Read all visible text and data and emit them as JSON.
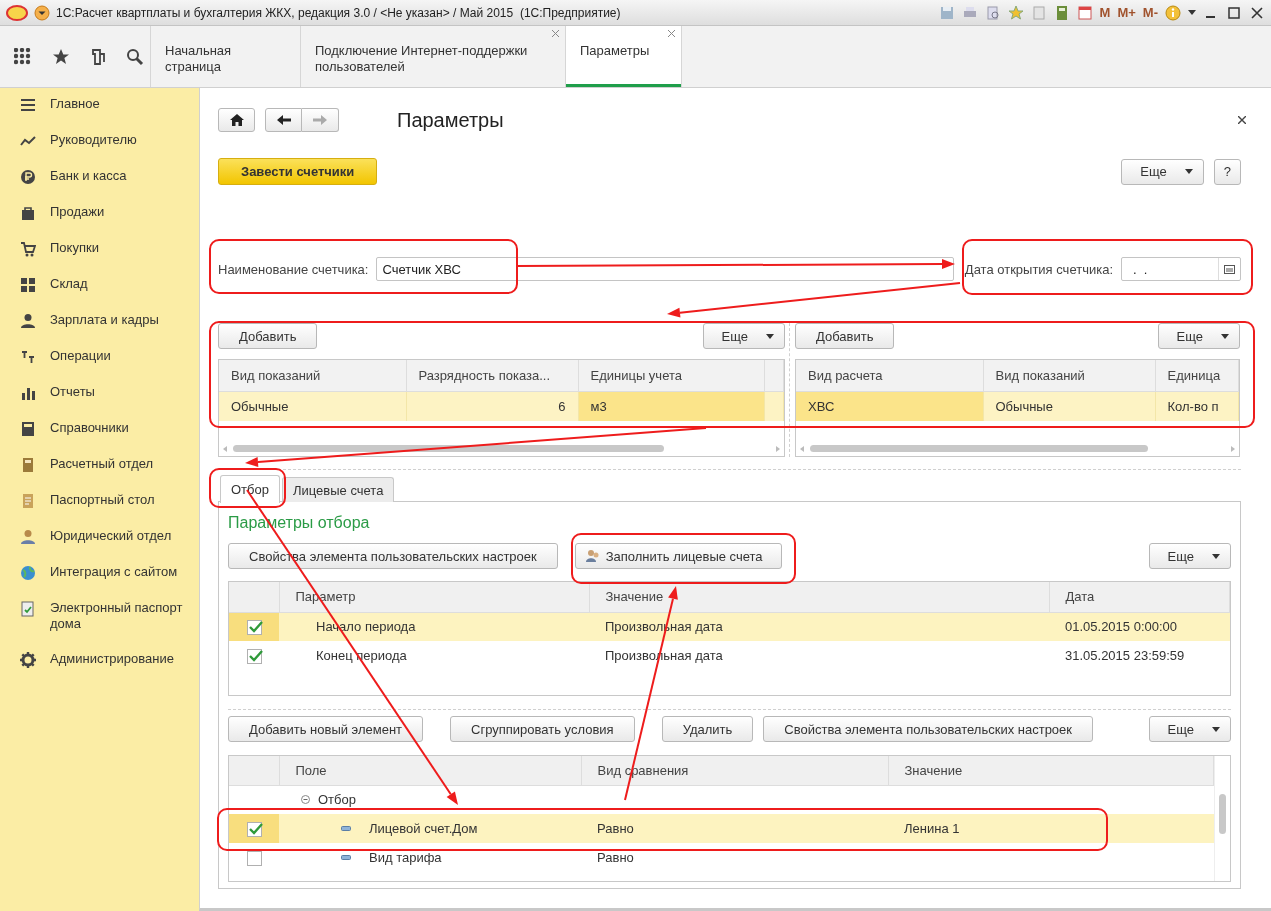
{
  "window": {
    "title": "1С:Расчет квартплаты и бухгалтерия ЖКХ, редакция 3.0 / <Не указан> / Май 2015  (1С:Предприятие)",
    "memory_buttons": [
      "M",
      "M+",
      "M-"
    ]
  },
  "open_tabs": [
    {
      "label": "Начальная страница",
      "selected": false,
      "closable": false
    },
    {
      "label": "Подключение Интернет-поддержки пользователей",
      "selected": false,
      "closable": true
    },
    {
      "label": "Параметры",
      "selected": true,
      "closable": true
    }
  ],
  "sidebar": {
    "items": [
      {
        "label": "Главное"
      },
      {
        "label": "Руководителю"
      },
      {
        "label": "Банк и касса"
      },
      {
        "label": "Продажи"
      },
      {
        "label": "Покупки"
      },
      {
        "label": "Склад"
      },
      {
        "label": "Зарплата и кадры"
      },
      {
        "label": "Операции"
      },
      {
        "label": "Отчеты"
      },
      {
        "label": "Справочники"
      },
      {
        "label": "Расчетный отдел"
      },
      {
        "label": "Паспортный стол"
      },
      {
        "label": "Юридический отдел"
      },
      {
        "label": "Интеграция с сайтом"
      },
      {
        "label": "Электронный паспорт дома"
      },
      {
        "label": "Администрирование"
      }
    ]
  },
  "form": {
    "title": "Параметры",
    "primary_button": "Завести счетчики",
    "more_button": "Еще",
    "help_button": "?",
    "meter_name": {
      "label": "Наименование счетчика:",
      "value": "Счетчик ХВС"
    },
    "open_date": {
      "label": "Дата открытия счетчика:",
      "value": ".  ."
    },
    "readings_table": {
      "add_button": "Добавить",
      "more_button": "Еще",
      "columns": [
        {
          "title": "Вид показаний",
          "numeric": false
        },
        {
          "title": "Разрядность показа...",
          "numeric": true
        },
        {
          "title": "Единицы учета",
          "numeric": false
        }
      ],
      "rows": [
        {
          "selected": true,
          "cells": [
            {
              "text": "Обычные",
              "current": false
            },
            {
              "text": "6",
              "current": false
            },
            {
              "text": "м3",
              "current": true
            }
          ]
        }
      ]
    },
    "calculation_table": {
      "add_button": "Добавить",
      "more_button": "Еще",
      "columns": [
        {
          "title": "Вид расчета",
          "numeric": false
        },
        {
          "title": "Вид показаний",
          "numeric": false
        },
        {
          "title": "Единица",
          "numeric": false
        }
      ],
      "rows": [
        {
          "selected": true,
          "cells": [
            {
              "text": "ХВС",
              "current": true
            },
            {
              "text": "Обычные",
              "current": false
            },
            {
              "text": "Кол-во п",
              "current": false
            }
          ]
        }
      ]
    },
    "tabs": [
      {
        "label": "Отбор",
        "selected": true
      },
      {
        "label": "Лицевые счета",
        "selected": false
      }
    ],
    "filter": {
      "title": "Параметры отбора",
      "buttons": [
        {
          "label": "Свойства элемента пользовательских настроек",
          "kind": "plain"
        },
        {
          "label": "Заполнить лицевые счета",
          "kind": "icon"
        }
      ],
      "more_button": "Еще",
      "parameters": {
        "columns": [
          "Параметр",
          "Значение",
          "Дата"
        ],
        "rows": [
          {
            "checked": true,
            "selected": true,
            "parameter": "Начало периода",
            "value": "Произвольная дата",
            "date": "01.05.2015 0:00:00"
          },
          {
            "checked": true,
            "selected": false,
            "parameter": "Конец периода",
            "value": "Произвольная дата",
            "date": "31.05.2015 23:59:59"
          }
        ]
      },
      "condition_buttons": [
        "Добавить новый элемент",
        "Сгруппировать условия",
        "Удалить",
        "Свойства элемента пользовательских настроек"
      ],
      "condition_more_button": "Еще",
      "conditions": {
        "columns": [
          "Поле",
          "Вид сравнения",
          "Значение"
        ],
        "rows": [
          {
            "kind": "group",
            "field": "Отбор",
            "expanded": true,
            "children": [
              {
                "kind": "item",
                "checked": true,
                "selected": true,
                "field": "Лицевой счет.Дом",
                "comparison": "Равно",
                "value": "Ленина 1"
              },
              {
                "kind": "item",
                "checked": false,
                "selected": false,
                "field": "Вид тарифа",
                "comparison": "Равно"
              }
            ]
          }
        ]
      }
    }
  }
}
